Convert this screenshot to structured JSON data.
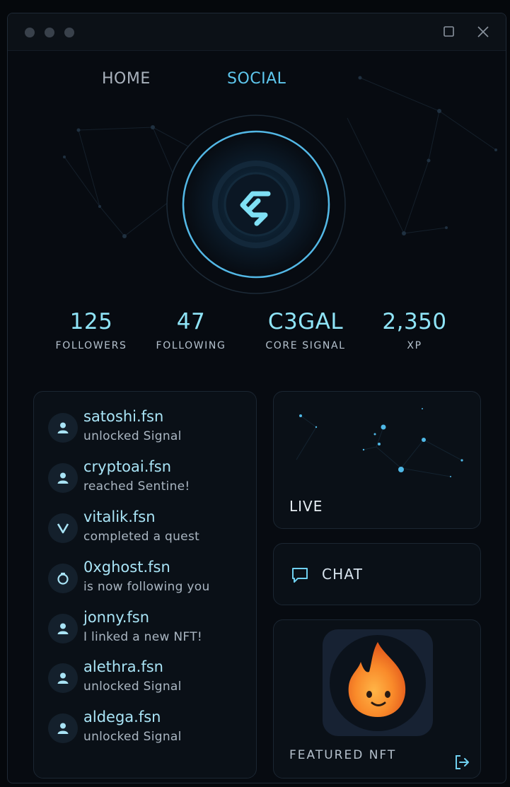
{
  "window": {
    "controls": [
      "maximize-icon",
      "close-icon"
    ]
  },
  "nav": {
    "tabs": [
      {
        "label": "HOME",
        "active": false
      },
      {
        "label": "SOCIAL",
        "active": true
      }
    ]
  },
  "emblem": {
    "icon": "core-signal-logo",
    "accent": "#5ec7ee"
  },
  "stats": [
    {
      "value": "125",
      "label": "FOLLOWERS"
    },
    {
      "value": "47",
      "label": "FOLLOWING"
    },
    {
      "value": "C3GAL",
      "label": "CORE SIGNAL"
    },
    {
      "value": "2,350",
      "label": "XP"
    }
  ],
  "feed": [
    {
      "icon": "user-icon",
      "name": "satoshi.fsn",
      "action": "unlocked Signal"
    },
    {
      "icon": "user-icon",
      "name": "cryptoai.fsn",
      "action": "reached Sentine!"
    },
    {
      "icon": "chevron-v-icon",
      "name": "vitalik.fsn",
      "action": "completed a quest"
    },
    {
      "icon": "ring-icon",
      "name": "0xghost.fsn",
      "action": "is now following you"
    },
    {
      "icon": "user-icon",
      "name": "jonny.fsn",
      "action": "I linked a new NFT!"
    },
    {
      "icon": "user-icon",
      "name": "alethra.fsn",
      "action": "unlocked Signal"
    },
    {
      "icon": "user-icon",
      "name": "aldega.fsn",
      "action": "unlocked Signal"
    }
  ],
  "live": {
    "label": "LIVE"
  },
  "chat": {
    "label": "CHAT",
    "icon": "chat-bubble-icon"
  },
  "featured": {
    "label": "FEATURED NFT",
    "image": "flame-mascot-icon",
    "action_icon": "logout-icon"
  },
  "colors": {
    "accent": "#5ec7ee",
    "stat_value": "#8fe4f7",
    "background": "#070b11",
    "panel": "#0a1017"
  }
}
